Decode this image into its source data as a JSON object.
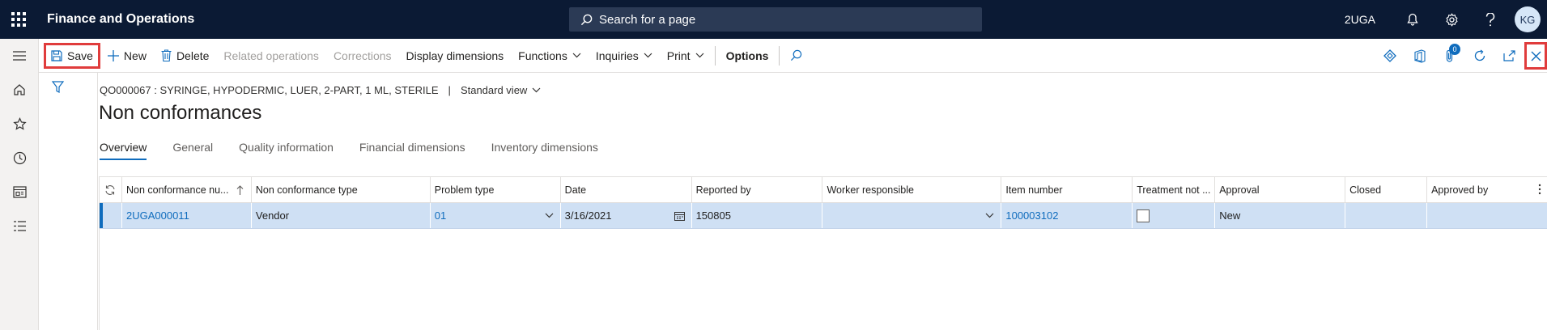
{
  "topbar": {
    "app_title": "Finance and Operations",
    "search_placeholder": "Search for a page",
    "company": "2UGA",
    "avatar_initials": "KG"
  },
  "actions": {
    "save": "Save",
    "new": "New",
    "delete": "Delete",
    "related_operations": "Related operations",
    "corrections": "Corrections",
    "display_dimensions": "Display dimensions",
    "functions": "Functions",
    "inquiries": "Inquiries",
    "print": "Print",
    "options": "Options",
    "attachments_count": "0"
  },
  "page": {
    "record_caption": "QO000067 : SYRINGE, HYPODERMIC, LUER, 2-PART, 1 ML, STERILE",
    "caption_separator": "|",
    "view": "Standard view",
    "title": "Non conformances"
  },
  "tabs": [
    {
      "label": "Overview",
      "active": true
    },
    {
      "label": "General",
      "active": false
    },
    {
      "label": "Quality information",
      "active": false
    },
    {
      "label": "Financial dimensions",
      "active": false
    },
    {
      "label": "Inventory dimensions",
      "active": false
    }
  ],
  "grid": {
    "columns": [
      "Non conformance nu...",
      "Non conformance type",
      "Problem type",
      "Date",
      "Reported by",
      "Worker responsible",
      "Item number",
      "Treatment not ...",
      "Approval",
      "Closed",
      "Approved by"
    ],
    "rows": [
      {
        "non_conformance_number": "2UGA000011",
        "non_conformance_type": "Vendor",
        "problem_type": "01",
        "date": "3/16/2021",
        "reported_by": "150805",
        "worker_responsible": "",
        "item_number": "100003102",
        "treatment_not_required": false,
        "approval": "New",
        "closed": "",
        "approved_by": ""
      }
    ]
  },
  "colors": {
    "topbar_bg": "#0b1a34",
    "accent": "#0f6cbd",
    "selected_row": "#cfe0f4",
    "highlight_box": "#e03c3c"
  }
}
